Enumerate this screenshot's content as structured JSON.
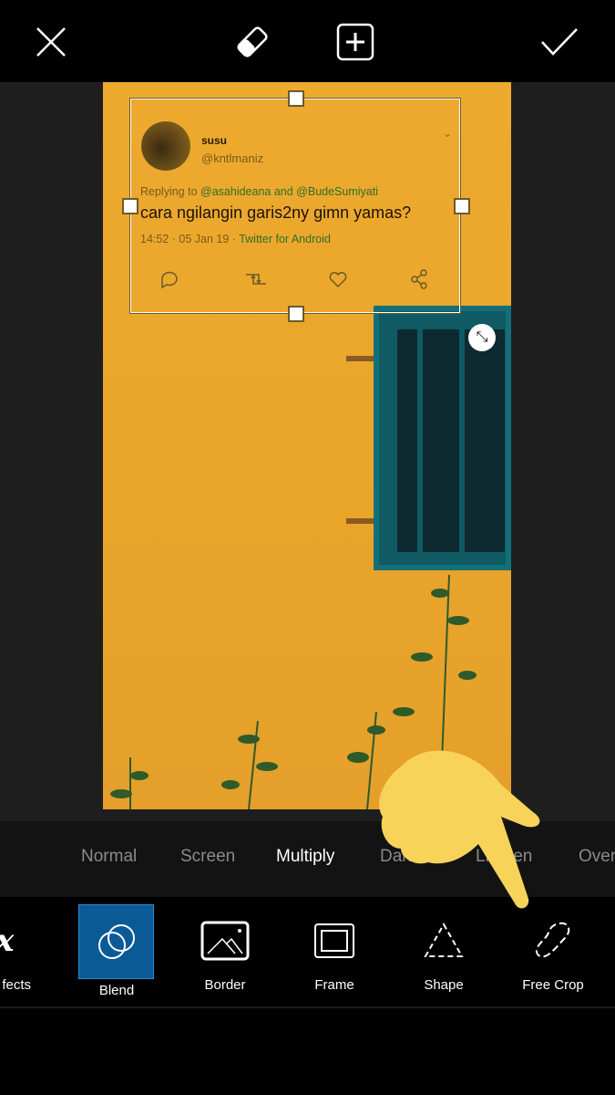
{
  "topbar": {
    "icons": [
      "close-icon",
      "eraser-icon",
      "add-icon",
      "check-icon"
    ]
  },
  "tweet": {
    "name": "susu",
    "handle": "@kntlmaniz",
    "replying_prefix": "Replying to",
    "reply_to": "@asahideana and @BudeSumiyati",
    "text": "cara ngilangin garis2ny gimn yamas?",
    "time": "14:52 · 05 Jan 19 ·",
    "source": "Twitter for Android"
  },
  "blend_modes": {
    "items": [
      "Normal",
      "Screen",
      "Multiply",
      "Darken",
      "Lighten",
      "Over"
    ],
    "selected": "Multiply"
  },
  "tools": {
    "items": [
      "fects",
      "Blend",
      "Border",
      "Frame",
      "Shape",
      "Free Crop"
    ],
    "selected": "Blend",
    "accent": "#0a5a96"
  },
  "colors": {
    "wall": "#eaa72c",
    "window": "#0f5a63",
    "hand": "#f7d35a"
  }
}
